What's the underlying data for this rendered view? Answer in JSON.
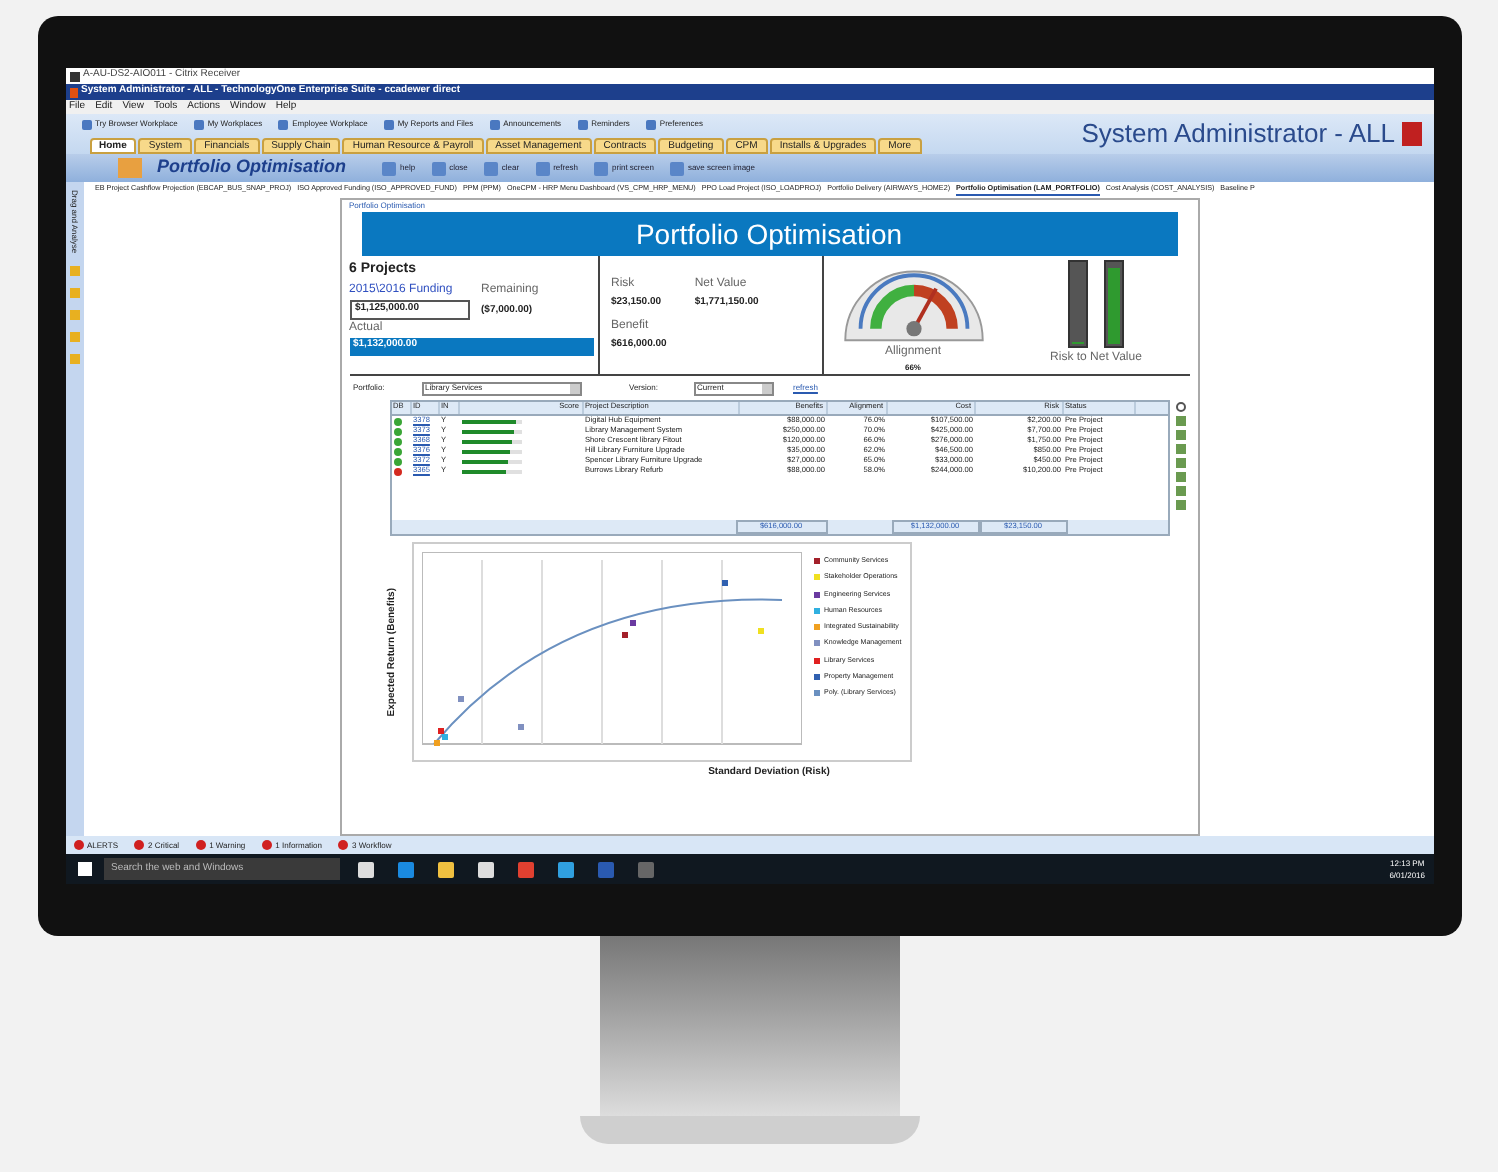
{
  "citrix_title": "A-AU-DS2-AIO011 - Citrix Receiver",
  "app_title": "System Administrator - ALL - TechnologyOne Enterprise Suite - ccadewer direct",
  "menu": [
    "File",
    "Edit",
    "View",
    "Tools",
    "Actions",
    "Window",
    "Help"
  ],
  "workplaces": [
    "Try Browser Workplace",
    "My Workplaces",
    "Employee Workplace",
    "My Reports and Files",
    "Announcements",
    "Reminders",
    "Preferences"
  ],
  "user": "System Administrator - ALL",
  "tabs": [
    {
      "label": "Home",
      "selected": true
    },
    {
      "label": "System",
      "selected": false
    },
    {
      "label": "Financials",
      "selected": false
    },
    {
      "label": "Supply Chain",
      "selected": false
    },
    {
      "label": "Human Resource & Payroll",
      "selected": false
    },
    {
      "label": "Asset Management",
      "selected": false
    },
    {
      "label": "Contracts",
      "selected": false
    },
    {
      "label": "Budgeting",
      "selected": false
    },
    {
      "label": "CPM",
      "selected": false
    },
    {
      "label": "Installs & Upgrades",
      "selected": false
    },
    {
      "label": "More",
      "selected": false
    }
  ],
  "page_title": "Portfolio Optimisation",
  "toolbar": [
    "help",
    "close",
    "clear",
    "refresh",
    "print screen",
    "save screen image"
  ],
  "sidebar_label": "Drag and Analyse",
  "doc_tabs": [
    {
      "label": "EB Project Cashflow Projection (EBCAP_BUS_SNAP_PROJ)",
      "selected": false
    },
    {
      "label": "ISO Approved Funding (ISO_APPROVED_FUND)",
      "selected": false
    },
    {
      "label": "PPM (PPM)",
      "selected": false
    },
    {
      "label": "OneCPM - HRP Menu Dashboard (VS_CPM_HRP_MENU)",
      "selected": false
    },
    {
      "label": "PPO Load Project (ISO_LOADPROJ)",
      "selected": false
    },
    {
      "label": "Portfolio Delivery (AIRWAYS_HOME2)",
      "selected": false
    },
    {
      "label": "Portfolio Optimisation (LAM_PORTFOLIO)",
      "selected": true
    },
    {
      "label": "Cost Analysis (COST_ANALYSIS)",
      "selected": false
    },
    {
      "label": "Baseline P",
      "selected": false
    }
  ],
  "breadcrumb": "Portfolio Optimisation",
  "banner": "Portfolio Optimisation",
  "summary": {
    "projects": "6 Projects",
    "funding_label": "2015\\2016 Funding",
    "funding": "$1,125,000.00",
    "actual_label": "Actual",
    "actual": "$1,132,000.00",
    "remaining_label": "Remaining",
    "remaining": "($7,000.00)",
    "risk_label": "Risk",
    "risk": "$23,150.00",
    "net_label": "Net Value",
    "net": "$1,771,150.00",
    "benefit_label": "Benefit",
    "benefit": "$616,000.00",
    "alignment_label": "Allignment",
    "alignment": "66%",
    "alignment_gauge": {
      "level": 0.66
    },
    "risk_bar": {
      "level": 0.03
    },
    "net_bar": {
      "level": 0.95
    },
    "risk_net_label": "Risk to Net Value"
  },
  "filters": {
    "portfolio_label": "Portfolio:",
    "portfolio": "Library Services",
    "version_label": "Version:",
    "version": "Current",
    "refresh": "refresh"
  },
  "table": {
    "columns": [
      "DB",
      "ID",
      "IN",
      "Score",
      "Project Description",
      "Benefits",
      "Alignment",
      "Cost",
      "Risk",
      "Status"
    ],
    "rows": [
      {
        "color": "#3aa636",
        "id": "3378",
        "in": "Y",
        "score": {
          "level": 0.92
        },
        "description": "Digital Hub Equipment",
        "benefits": "$88,000.00",
        "alignment": "76.0%",
        "cost": "$107,500.00",
        "risk": "$2,200.00",
        "status": "Pre Project"
      },
      {
        "color": "#3aa636",
        "id": "3373",
        "in": "Y",
        "score": {
          "level": 0.88
        },
        "description": "Library Management System",
        "benefits": "$250,000.00",
        "alignment": "70.0%",
        "cost": "$425,000.00",
        "risk": "$7,700.00",
        "status": "Pre Project"
      },
      {
        "color": "#3aa636",
        "id": "3368",
        "in": "Y",
        "score": {
          "level": 0.86
        },
        "description": "Shore Crescent library Fitout",
        "benefits": "$120,000.00",
        "alignment": "66.0%",
        "cost": "$276,000.00",
        "risk": "$1,750.00",
        "status": "Pre Project"
      },
      {
        "color": "#3aa636",
        "id": "3376",
        "in": "Y",
        "score": {
          "level": 0.8
        },
        "description": "Hill Library Furniture Upgrade",
        "benefits": "$35,000.00",
        "alignment": "62.0%",
        "cost": "$46,500.00",
        "risk": "$850.00",
        "status": "Pre Project"
      },
      {
        "color": "#3aa636",
        "id": "3372",
        "in": "Y",
        "score": {
          "level": 0.78
        },
        "description": "Spencer Library Furniture Upgrade",
        "benefits": "$27,000.00",
        "alignment": "65.0%",
        "cost": "$33,000.00",
        "risk": "$450.00",
        "status": "Pre Project"
      },
      {
        "color": "#d42a20",
        "id": "3365",
        "in": "Y",
        "score": {
          "level": 0.75
        },
        "description": "Burrows Library Refurb",
        "benefits": "$88,000.00",
        "alignment": "58.0%",
        "cost": "$244,000.00",
        "risk": "$10,200.00",
        "status": "Pre Project"
      }
    ],
    "totals": {
      "benefits": "$616,000.00",
      "cost": "$1,132,000.00",
      "risk": "$23,150.00"
    }
  },
  "chart": {
    "ylabel": "Expected Return (Benefits)",
    "xlabel": "Standard Deviation (Risk)",
    "legend": [
      {
        "label": "Community Services",
        "color": "#a3202a"
      },
      {
        "label": "Stakeholder Operations",
        "color": "#f0e020"
      },
      {
        "label": "Engineering Services",
        "color": "#6a3aa0"
      },
      {
        "label": "Human Resources",
        "color": "#30b0e0"
      },
      {
        "label": "Integrated Sustainability",
        "color": "#f0a020"
      },
      {
        "label": "Knowledge Management",
        "color": "#8090c0"
      },
      {
        "label": "Library Services",
        "color": "#e02020"
      },
      {
        "label": "Property Management",
        "color": "#3060b0"
      },
      {
        "label": "Poly. (Library Services)",
        "color": "#6a90c0"
      }
    ]
  },
  "alerts": [
    "ALERTS",
    "2 Critical",
    "1 Warning",
    "1 Information",
    "3 Workflow"
  ],
  "taskbar": {
    "search_placeholder": "Search the web and Windows",
    "time": "12:13 PM",
    "date": "6/01/2016"
  }
}
